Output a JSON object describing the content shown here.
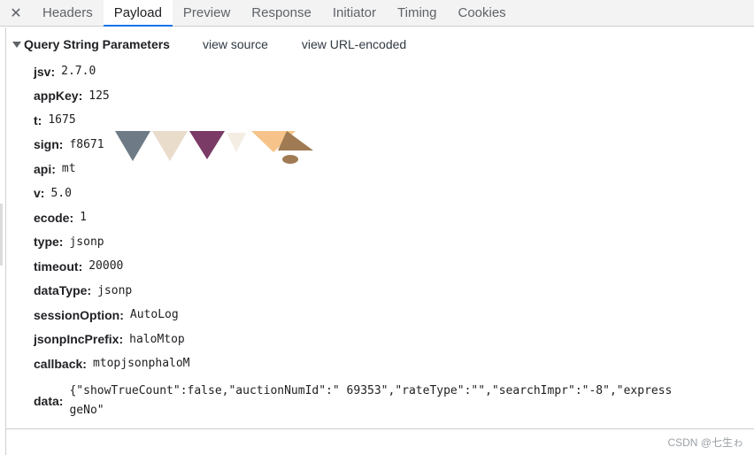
{
  "tabs": {
    "close_symbol": "✕",
    "items": [
      "Headers",
      "Payload",
      "Preview",
      "Response",
      "Initiator",
      "Timing",
      "Cookies"
    ],
    "active": "Payload"
  },
  "section": {
    "title": "Query String Parameters",
    "view_source": "view source",
    "view_url_encoded": "view URL-encoded"
  },
  "params": [
    {
      "key": "jsv",
      "value": "2.7.0"
    },
    {
      "key": "appKey",
      "value": "125"
    },
    {
      "key": "t",
      "value": "1675"
    },
    {
      "key": "sign",
      "value": "f8671"
    },
    {
      "key": "api",
      "value": "mt"
    },
    {
      "key": "v",
      "value": "5.0"
    },
    {
      "key": "ecode",
      "value": "1"
    },
    {
      "key": "type",
      "value": "jsonp"
    },
    {
      "key": "timeout",
      "value": "20000"
    },
    {
      "key": "dataType",
      "value": "jsonp"
    },
    {
      "key": "sessionOption",
      "value": "AutoLog"
    },
    {
      "key": "jsonpIncPrefix",
      "value": "haloMtop"
    },
    {
      "key": "callback",
      "value": "mtopjsonphaloM"
    }
  ],
  "data_param": {
    "key": "data",
    "line1": "{\"showTrueCount\":false,\"auctionNumId\":\"      69353\",\"rateType\":\"\",\"searchImpr\":\"-8\",\"express",
    "line2": "geNo\""
  },
  "watermark": "CSDN @七生ゎ",
  "redaction_colors": [
    "#6e7b86",
    "#e9dccb",
    "#7a3b66",
    "#f3ede4",
    "#f6c48a",
    "#a07a52"
  ]
}
